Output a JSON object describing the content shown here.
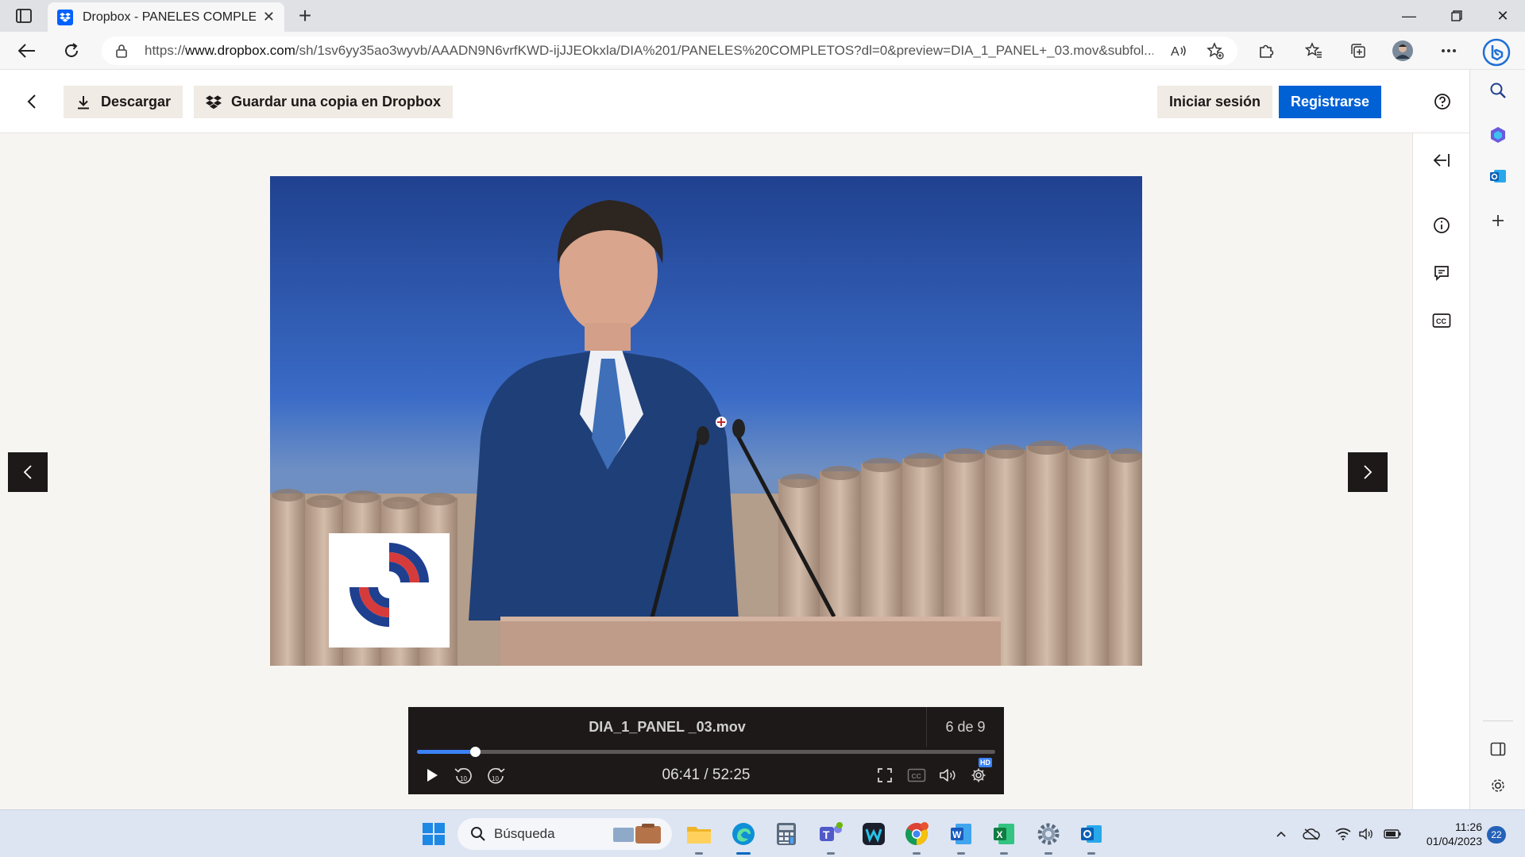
{
  "browser": {
    "tab": {
      "title": "Dropbox - PANELES COMPLETOS"
    },
    "url": {
      "prefix": "https://",
      "domain": "www.dropbox.com",
      "path": "/sh/1sv6yy35ao3wyvb/AAADN9N6vrfKWD-ijJJEOkxla/DIA%201/PANELES%20COMPLETOS?dl=0&preview=DIA_1_PANEL+_03.mov&subfol..."
    }
  },
  "header": {
    "download_label": "Descargar",
    "save_copy_label": "Guardar una copia en Dropbox",
    "signin_label": "Iniciar sesión",
    "register_label": "Registrarse"
  },
  "player": {
    "filename": "DIA_1_PANEL _03.mov",
    "counter": "6 de 9",
    "time": "06:41 / 52:25",
    "progress_fraction": 0.1,
    "hd_label": "HD",
    "rewind_label": "10",
    "forward_label": "10"
  },
  "taskbar": {
    "search_placeholder": "Búsqueda",
    "time": "11:26",
    "date": "01/04/2023",
    "notification_count": "22"
  },
  "colors": {
    "accent": "#0061d5",
    "progress": "#3b82f6",
    "player_bg": "#1e1919"
  }
}
